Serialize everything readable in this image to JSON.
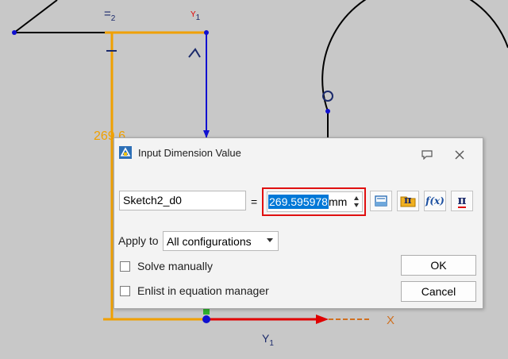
{
  "canvas": {
    "dimension_label": "269.6",
    "relation_equal": "=",
    "relation_equal_index": "2",
    "y_axis_top": "Y",
    "y_axis_top_index": "1",
    "y_axis_bottom": "Y",
    "y_axis_bottom_index": "1",
    "x_axis": "X"
  },
  "dialog": {
    "title": "Input Dimension Value",
    "name_value": "Sketch2_d0",
    "equals": "=",
    "value": "269.595978",
    "unit": "mm",
    "apply_to_label": "Apply to",
    "apply_to_value": "All configurations",
    "solve_manually_label": "Solve manually",
    "enlist_label": "Enlist in equation manager",
    "ok_label": "OK",
    "cancel_label": "Cancel",
    "pi_label": "π",
    "fx_label": "f(x)"
  },
  "colors": {
    "sketch_orange": "#f0a000",
    "sketch_blue": "#1010d0",
    "axis_red": "#e00000",
    "highlight": "#0078d7",
    "focus_border": "#e01010"
  }
}
